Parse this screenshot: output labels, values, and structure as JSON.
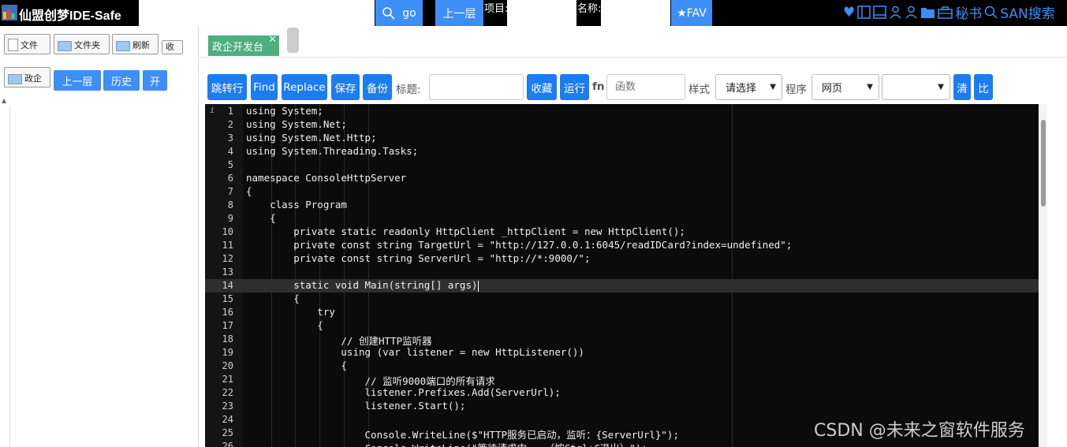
{
  "header": {
    "app_title": "仙盟创梦IDE-Safe",
    "go_label": "go",
    "up_label": "上一层",
    "project_label": "项目:",
    "name_label": "名称:",
    "fav_label": "★FAV",
    "secretary_label": "秘书",
    "san_search_label": "SAN搜索"
  },
  "sidebar": {
    "file_button": "文件",
    "folder_button": "文件夹",
    "refresh_button": "刷新",
    "collect_button": "收",
    "gov_folder": "政企",
    "up_button": "上一层",
    "history_button": "历史",
    "open_button": "开"
  },
  "tabs": [
    {
      "label": "政企开发台",
      "close": "✕"
    }
  ],
  "toolbar": {
    "jump_button": "跳转行",
    "find_button": "Find",
    "replace_button": "Replace",
    "save_button": "保存",
    "backup_button": "备份",
    "title_label": "标题:",
    "title_value": "",
    "favorite_button": "收藏",
    "run_button": "运行",
    "fn_label": "fn",
    "fn_placeholder": "函数",
    "style_label": "样式",
    "style_selected": "请选择",
    "program_label": "程序",
    "program_selected": "网页",
    "extra_selected": "",
    "clear_button": "清",
    "compare_button": "比"
  },
  "editor": {
    "active_line": 14,
    "lines": [
      "using System;",
      "using System.Net;",
      "using System.Net.Http;",
      "using System.Threading.Tasks;",
      "",
      "namespace ConsoleHttpServer",
      "{",
      "    class Program",
      "    {",
      "        private static readonly HttpClient _httpClient = new HttpClient();",
      "        private const string TargetUrl = \"http://127.0.0.1:6045/readIDCard?index=undefined\";",
      "        private const string ServerUrl = \"http://*:9000/\";",
      "",
      "        static void Main(string[] args)",
      "        {",
      "            try",
      "            {",
      "                // 创建HTTP监听器",
      "                using (var listener = new HttpListener())",
      "                {",
      "                    // 监听9000端口的所有请求",
      "                    listener.Prefixes.Add(ServerUrl);",
      "                    listener.Start();",
      "",
      "                    Console.WriteLine($\"HTTP服务已启动，监听：{ServerUrl}\");",
      "                    Console.WriteLine(\"等待请求中...（按Ctrl+C退出）\");"
    ]
  },
  "watermark": "CSDN @未来之窗软件服务"
}
